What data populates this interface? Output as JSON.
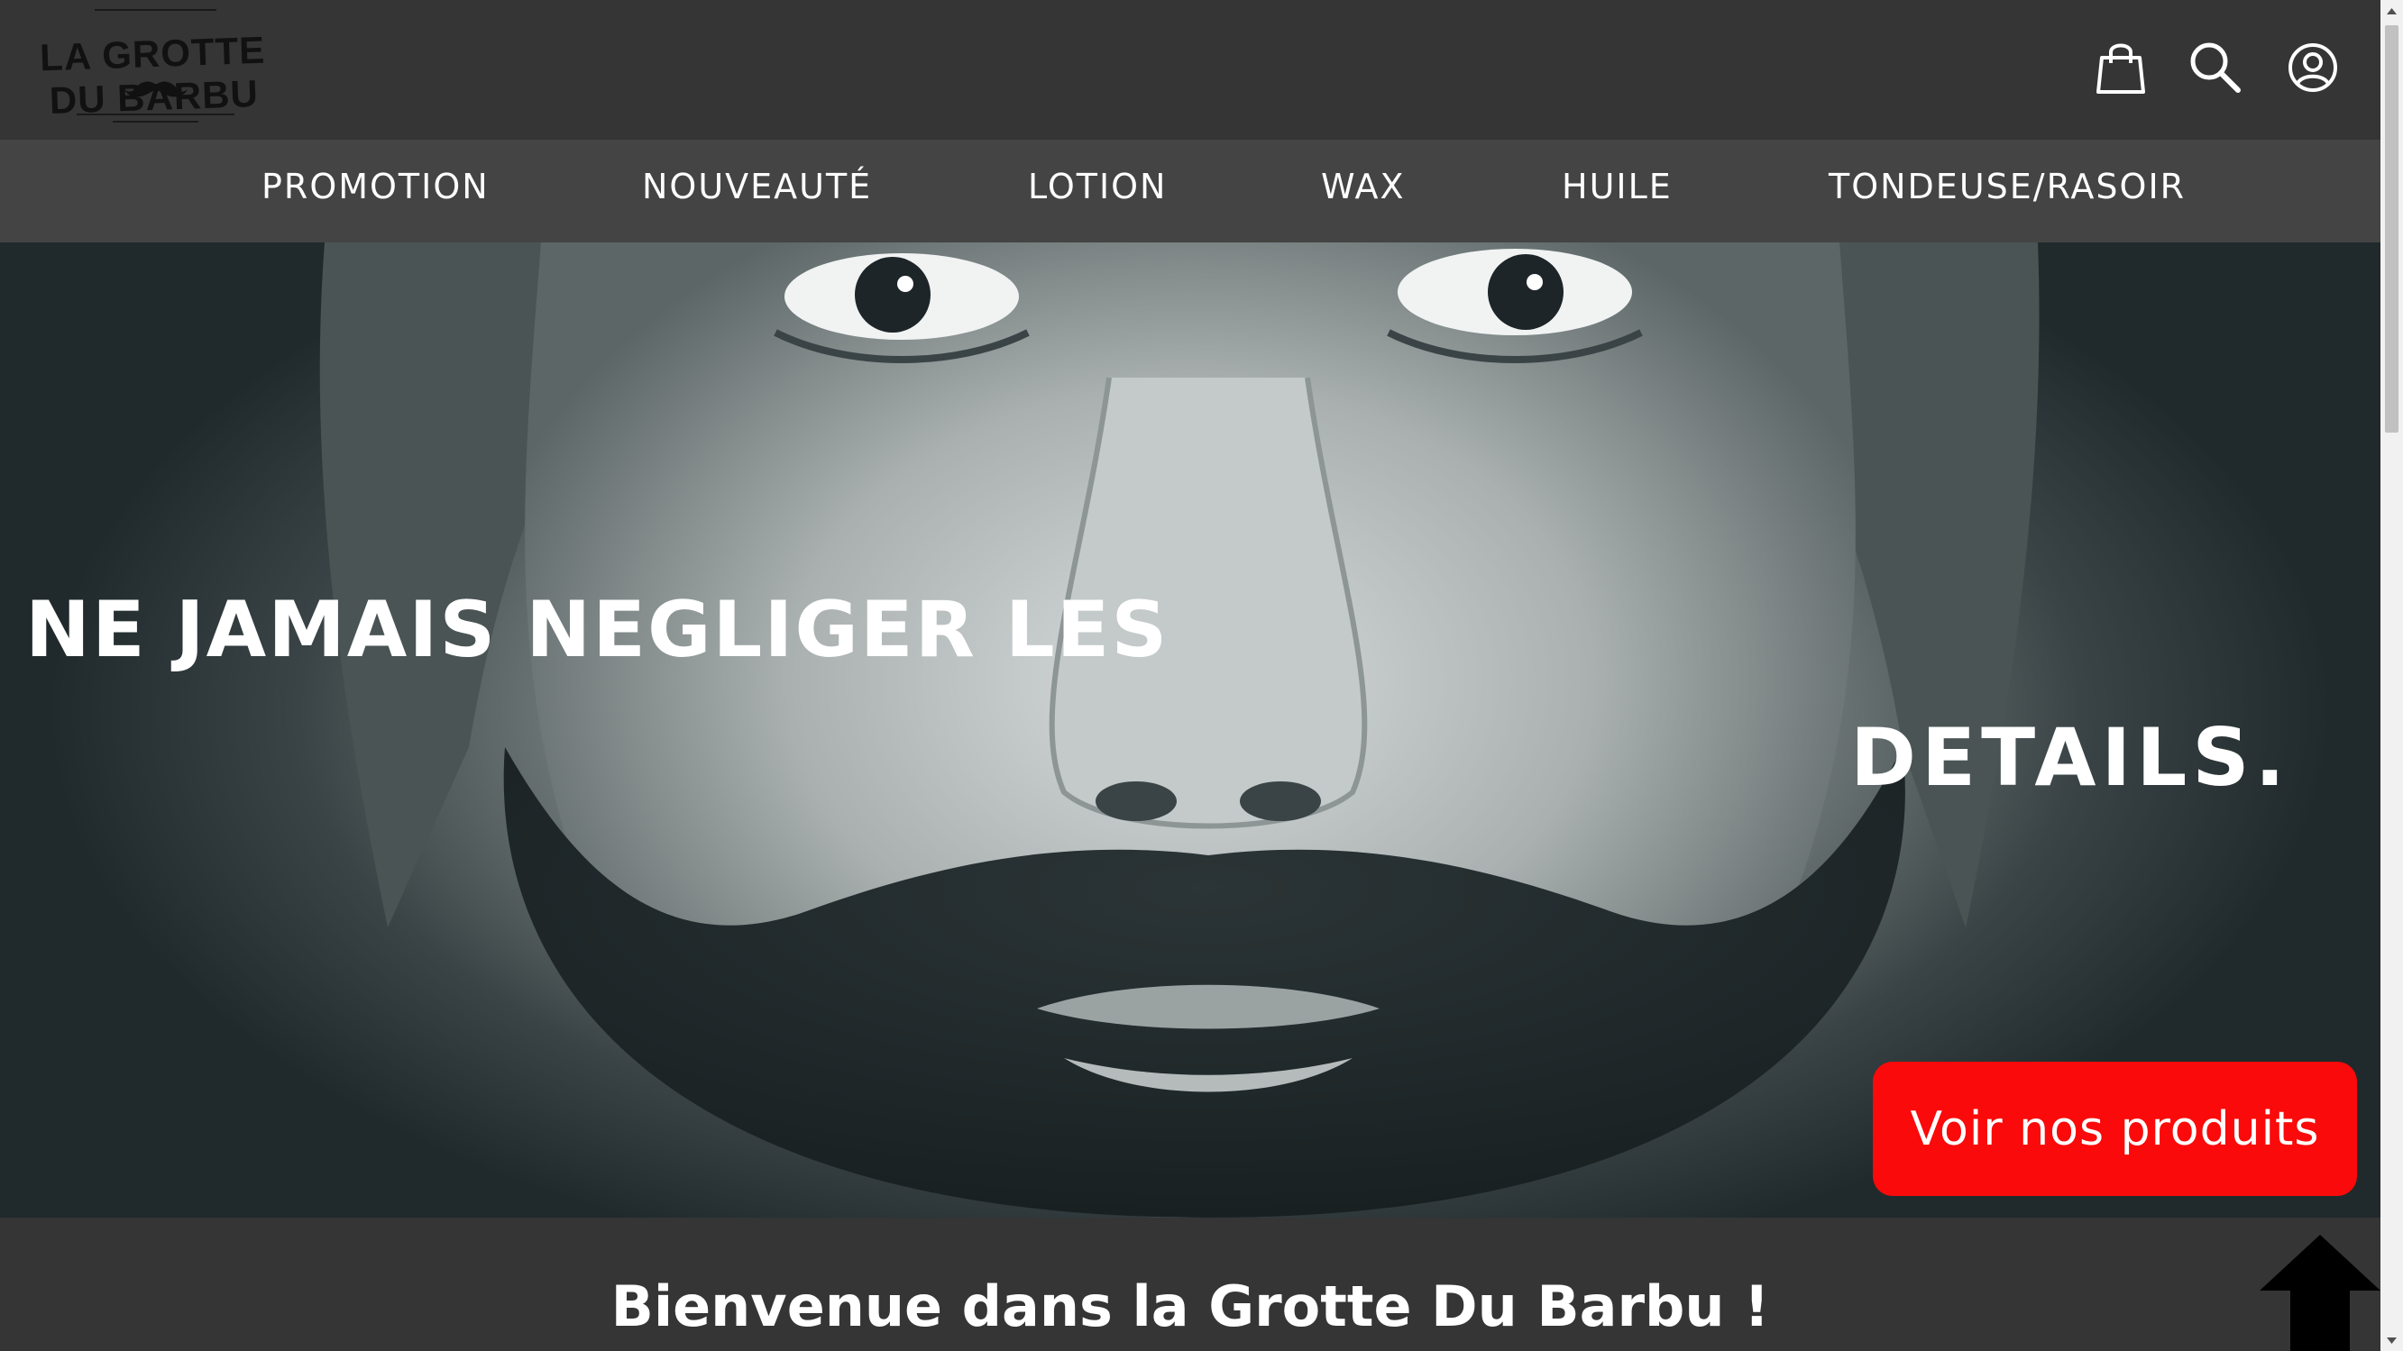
{
  "header": {
    "logo_text": "LA GROTTE DU BARBU",
    "icons": [
      "shopping-bag-icon",
      "search-icon",
      "account-icon"
    ]
  },
  "nav": {
    "items": [
      {
        "label": "PROMOTION"
      },
      {
        "label": "NOUVEAUTÉ"
      },
      {
        "label": "LOTION"
      },
      {
        "label": "WAX"
      },
      {
        "label": "HUILE"
      },
      {
        "label": "TONDEUSE/RASOIR"
      }
    ]
  },
  "hero": {
    "tagline_part1": "NE JAMAIS NEGLIGER LES",
    "tagline_part2": "DETAILS.",
    "cta_label": "Voir nos produits"
  },
  "welcome": {
    "title": "Bienvenue dans la Grotte Du Barbu !"
  },
  "colors": {
    "header_bg": "#353535",
    "nav_bg": "#444444",
    "cta_bg": "#fa0a0a",
    "text": "#ffffff"
  }
}
